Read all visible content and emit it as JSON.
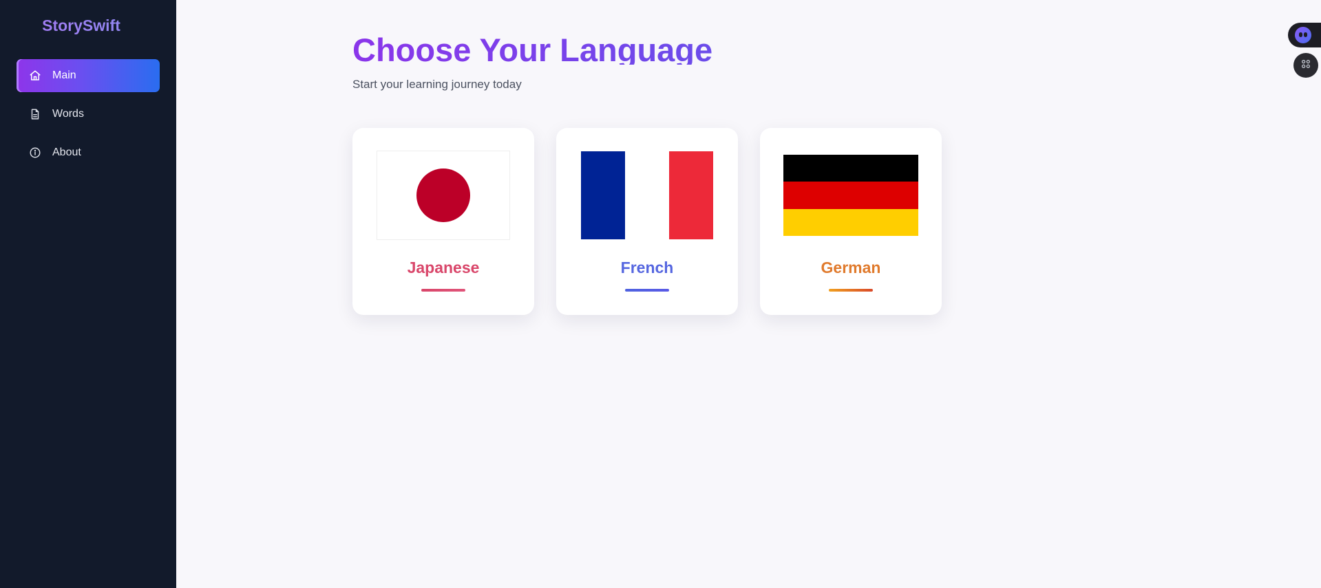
{
  "app": {
    "brand": "StorySwift"
  },
  "sidebar": {
    "items": [
      {
        "label": "Main",
        "icon": "home-icon",
        "active": true
      },
      {
        "label": "Words",
        "icon": "document-icon",
        "active": false
      },
      {
        "label": "About",
        "icon": "info-icon",
        "active": false
      }
    ]
  },
  "page": {
    "title": "Choose Your Language",
    "subtitle": "Start your learning journey today"
  },
  "languages": [
    {
      "name": "Japanese",
      "flag": "japan-flag",
      "text_color": "#d9466a",
      "underline": [
        "#d9466a",
        "#e0557a"
      ]
    },
    {
      "name": "French",
      "flag": "france-flag",
      "text_color": "#5566e0",
      "underline": [
        "#4f63e0",
        "#5a5ae6"
      ]
    },
    {
      "name": "German",
      "flag": "germany-flag",
      "text_color": "#e07a2c",
      "underline": [
        "#f0a020",
        "#d94a2a"
      ]
    }
  ],
  "colors": {
    "sidebar_bg": "#121a2b",
    "accent_start": "#8e35ea",
    "accent_end": "#2a6df0",
    "page_bg": "#f8f7fb",
    "jp_red": "#bc0028",
    "fr_blue": "#002395",
    "fr_white": "#ffffff",
    "fr_red": "#ed2939",
    "de_black": "#000000",
    "de_red": "#dd0000",
    "de_gold": "#ffce00"
  },
  "floating": {
    "assistant_icon": "assistant-bot-icon",
    "apps_icon": "command-grid-icon"
  }
}
